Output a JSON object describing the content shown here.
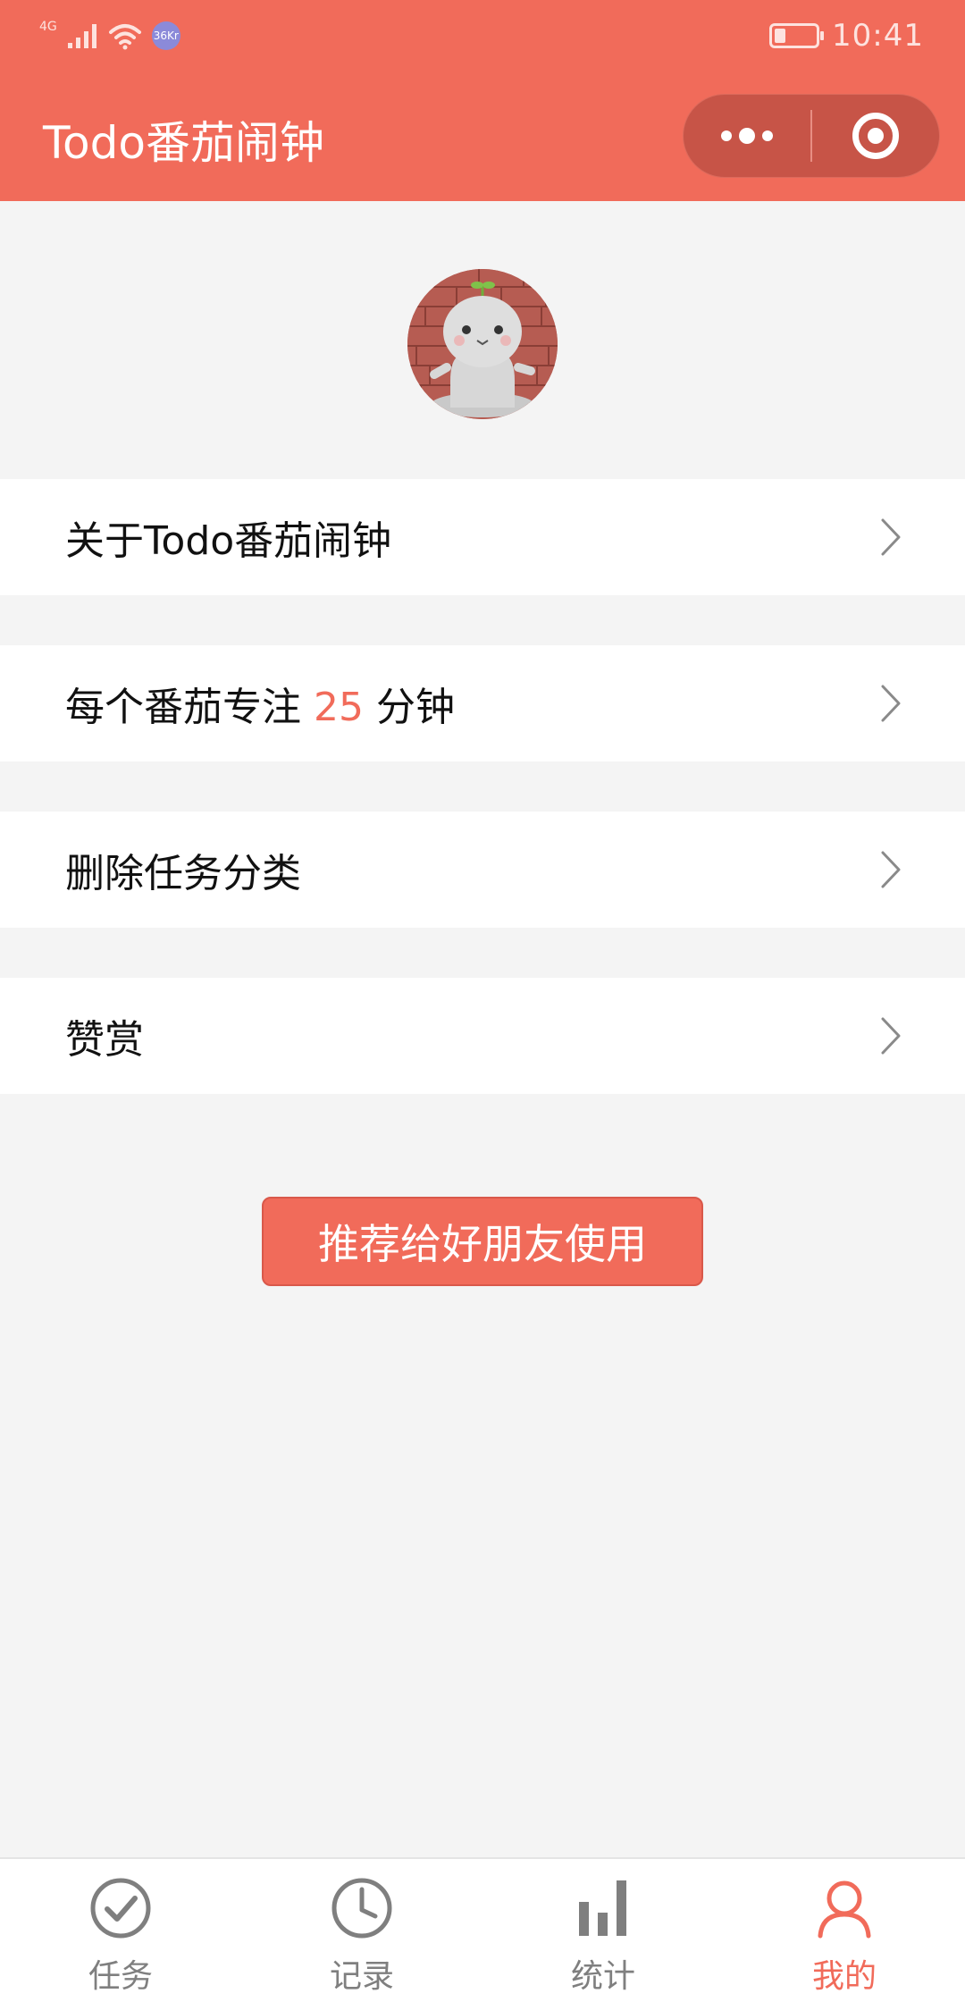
{
  "status_bar": {
    "network": "4G",
    "badge": "36Kr",
    "time": "10:41"
  },
  "header": {
    "title": "Todo番茄闹钟",
    "capsule": {
      "more_icon": "more-dots-icon",
      "close_icon": "target-icon"
    }
  },
  "profile": {
    "avatar_icon": "cartoon-avatar"
  },
  "menu": {
    "about": "关于Todo番茄闹钟",
    "focus_prefix": "每个番茄专注 ",
    "focus_minutes": "25",
    "focus_suffix": " 分钟",
    "delete_categories": "删除任务分类",
    "reward": "赞赏"
  },
  "share_button": "推荐给好朋友使用",
  "tabs": [
    {
      "label": "任务",
      "icon": "check-circle-icon",
      "active": false
    },
    {
      "label": "记录",
      "icon": "clock-icon",
      "active": false
    },
    {
      "label": "统计",
      "icon": "bar-chart-icon",
      "active": false
    },
    {
      "label": "我的",
      "icon": "user-icon",
      "active": true
    }
  ],
  "colors": {
    "accent": "#f16b5a",
    "capsule": "#c75447",
    "background": "#f4f4f4",
    "tab_inactive": "#7f7f7f"
  }
}
